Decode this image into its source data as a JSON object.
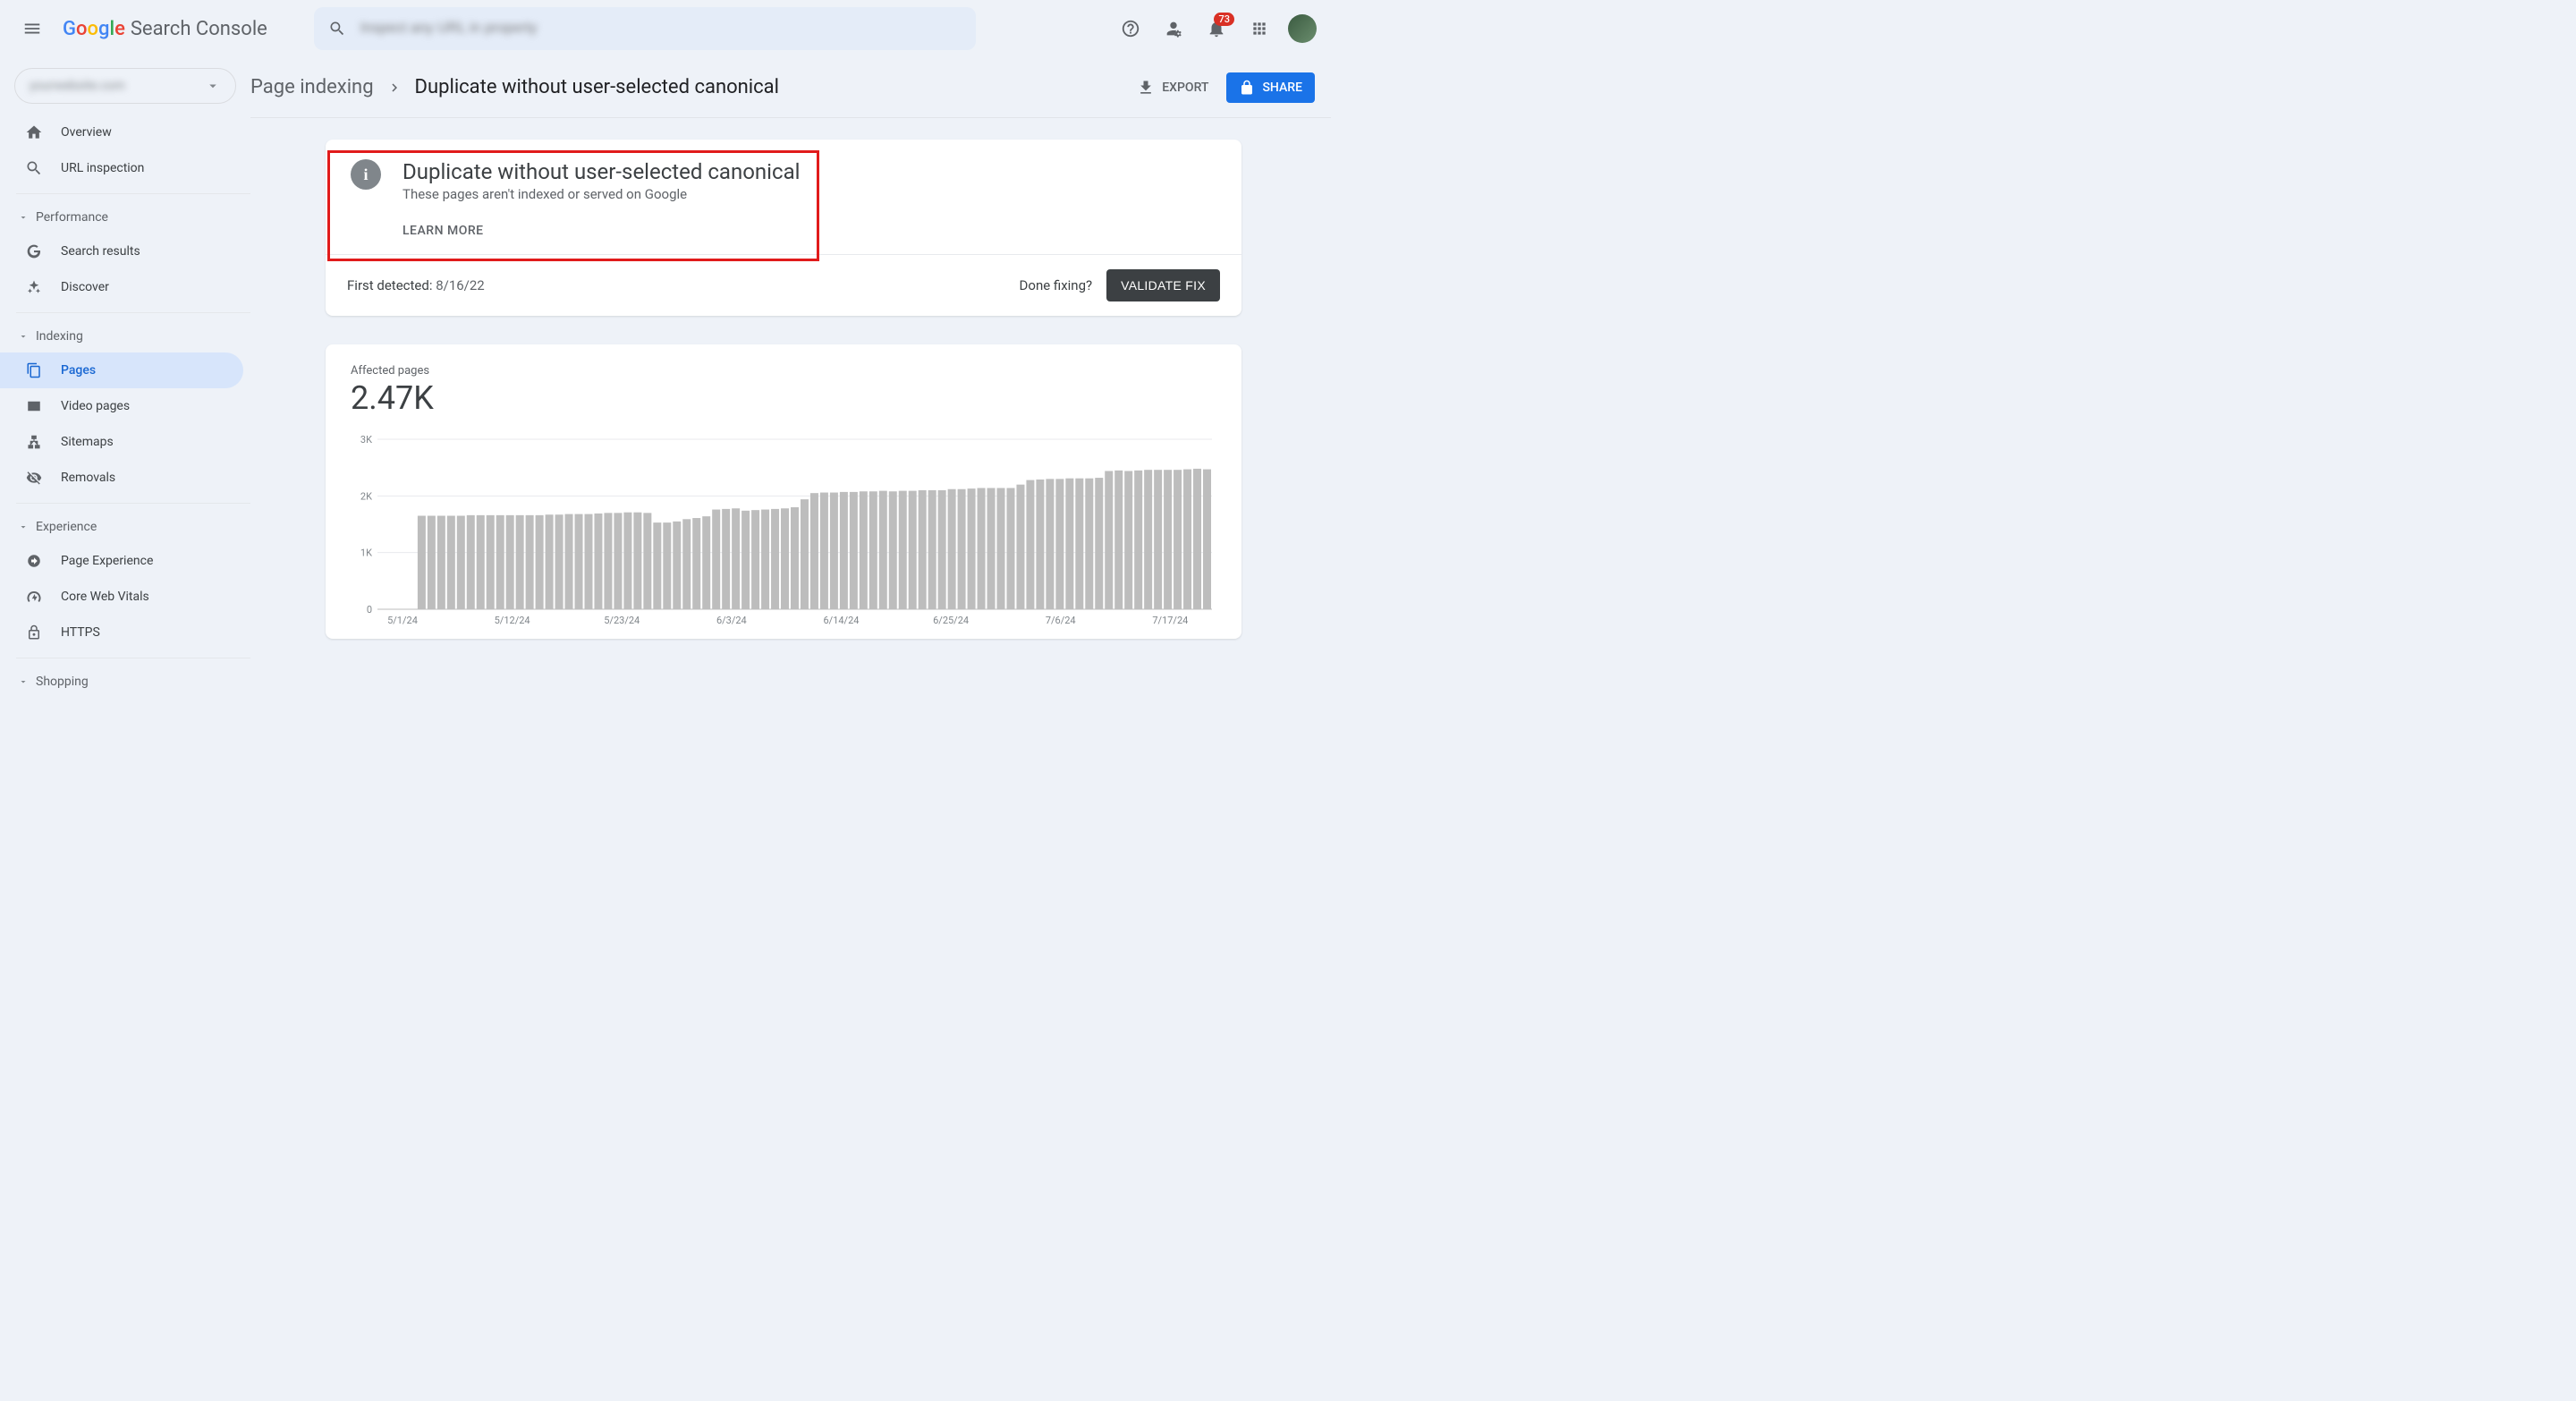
{
  "header": {
    "product_name": "Search Console",
    "search_placeholder": "Inspect any URL in property",
    "notification_count": "73"
  },
  "sidebar": {
    "property_name": "yourwebsite.com",
    "items_top": [
      {
        "label": "Overview",
        "name": "sidebar-item-overview"
      },
      {
        "label": "URL inspection",
        "name": "sidebar-item-url-inspection"
      }
    ],
    "sections": [
      {
        "title": "Performance",
        "items": [
          {
            "label": "Search results",
            "name": "sidebar-item-search-results"
          },
          {
            "label": "Discover",
            "name": "sidebar-item-discover"
          }
        ]
      },
      {
        "title": "Indexing",
        "items": [
          {
            "label": "Pages",
            "name": "sidebar-item-pages",
            "active": true
          },
          {
            "label": "Video pages",
            "name": "sidebar-item-video-pages"
          },
          {
            "label": "Sitemaps",
            "name": "sidebar-item-sitemaps"
          },
          {
            "label": "Removals",
            "name": "sidebar-item-removals"
          }
        ]
      },
      {
        "title": "Experience",
        "items": [
          {
            "label": "Page Experience",
            "name": "sidebar-item-page-experience"
          },
          {
            "label": "Core Web Vitals",
            "name": "sidebar-item-core-web-vitals"
          },
          {
            "label": "HTTPS",
            "name": "sidebar-item-https"
          }
        ]
      },
      {
        "title": "Shopping",
        "items": []
      }
    ]
  },
  "breadcrumb": {
    "parent": "Page indexing",
    "current": "Duplicate without user-selected canonical",
    "export_label": "EXPORT",
    "share_label": "SHARE"
  },
  "issue": {
    "title": "Duplicate without user-selected canonical",
    "subtitle": "These pages aren't indexed or served on Google",
    "learn_more": "LEARN MORE",
    "first_detected_label": "First detected: ",
    "first_detected_date": "8/16/22",
    "done_fixing": "Done fixing?",
    "validate_label": "VALIDATE FIX"
  },
  "chart": {
    "affected_label": "Affected pages",
    "affected_value": "2.47K"
  },
  "chart_data": {
    "type": "bar",
    "title": "Affected pages",
    "ylabel": "",
    "xlabel": "",
    "ylim": [
      0,
      3000
    ],
    "yticks": [
      0,
      1000,
      2000,
      3000
    ],
    "ytick_labels": [
      "0",
      "1K",
      "2K",
      "3K"
    ],
    "xtick_labels": [
      "5/1/24",
      "5/12/24",
      "5/23/24",
      "6/3/24",
      "6/14/24",
      "6/25/24",
      "7/6/24",
      "7/17/24"
    ],
    "values": [
      0,
      0,
      0,
      0,
      1650,
      1650,
      1650,
      1650,
      1650,
      1660,
      1660,
      1660,
      1660,
      1660,
      1660,
      1660,
      1660,
      1670,
      1670,
      1680,
      1680,
      1680,
      1690,
      1700,
      1700,
      1710,
      1710,
      1700,
      1530,
      1530,
      1550,
      1590,
      1610,
      1640,
      1760,
      1770,
      1780,
      1740,
      1750,
      1760,
      1770,
      1780,
      1800,
      1940,
      2050,
      2060,
      2060,
      2070,
      2070,
      2080,
      2080,
      2090,
      2080,
      2090,
      2090,
      2100,
      2100,
      2100,
      2120,
      2120,
      2130,
      2140,
      2140,
      2140,
      2140,
      2200,
      2280,
      2290,
      2300,
      2300,
      2310,
      2310,
      2310,
      2320,
      2440,
      2450,
      2440,
      2450,
      2460,
      2460,
      2460,
      2460,
      2470,
      2480,
      2470
    ]
  }
}
